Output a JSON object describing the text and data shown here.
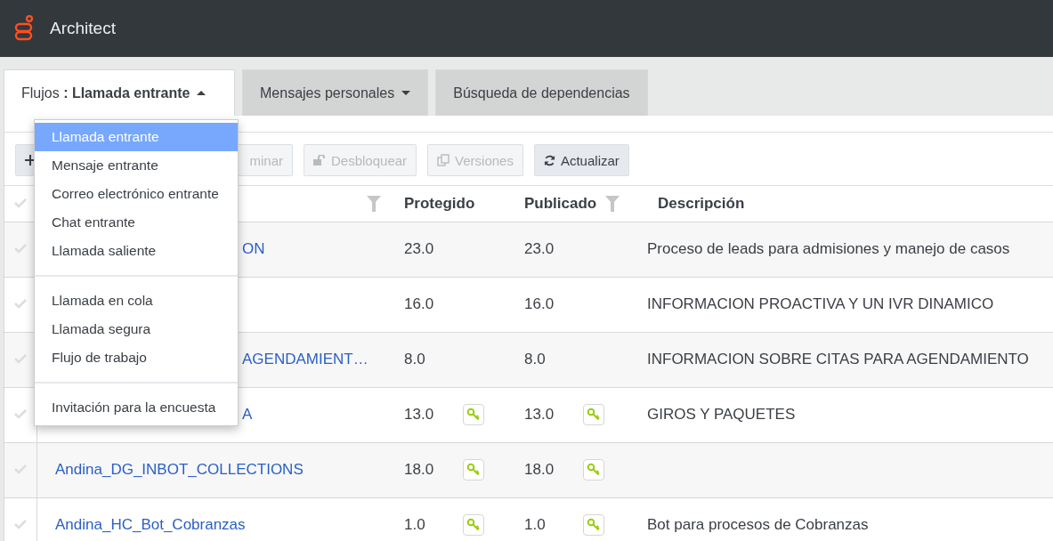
{
  "app": {
    "title": "Architect"
  },
  "tabs": [
    {
      "label": "Flujos **: Llamada entrante**",
      "selected": true,
      "expanded": true
    },
    {
      "label": "Mensajes personales",
      "selected": false,
      "expanded": false
    },
    {
      "label": "Búsqueda de dependencias",
      "selected": false
    }
  ],
  "flow_menu": {
    "groups": [
      [
        {
          "label": "Llamada entrante",
          "selected": true
        },
        {
          "label": "Mensaje entrante",
          "selected": false
        },
        {
          "label": "Correo electrónico entrante",
          "selected": false
        },
        {
          "label": "Chat entrante",
          "selected": false
        },
        {
          "label": "Llamada saliente",
          "selected": false
        }
      ],
      [
        {
          "label": "Llamada en cola",
          "selected": false
        },
        {
          "label": "Llamada segura",
          "selected": false
        },
        {
          "label": "Flujo de trabajo",
          "selected": false
        }
      ],
      [
        {
          "label": "Invitación para la encuesta",
          "selected": false
        }
      ]
    ]
  },
  "toolbar": [
    {
      "kind": "add",
      "disabled": false
    },
    {
      "kind": "delete",
      "label": "minar",
      "disabled": true
    },
    {
      "kind": "unlock",
      "label": "Desbloquear",
      "disabled": true
    },
    {
      "kind": "versions",
      "label": "Versiones",
      "disabled": true
    },
    {
      "kind": "refresh",
      "label": "Actualizar",
      "disabled": false
    }
  ],
  "table": {
    "columns": [
      {
        "filter": true
      },
      {
        "label": "Protegido",
        "filter": false
      },
      {
        "label": "Publicado",
        "filter": true
      },
      {
        "label": "Descripción",
        "filter": false
      }
    ],
    "rows": [
      {
        "name_fragment": "ON",
        "protected": "23.0",
        "protected_key": false,
        "published": "23.0",
        "published_key": false,
        "description": "Proceso de leads para admisiones y manejo de casos"
      },
      {
        "protected": "16.0",
        "protected_key": false,
        "published": "16.0",
        "published_key": false,
        "description": "INFORMACION PROACTIVA Y UN IVR DINAMICO"
      },
      {
        "name_fragment": "AGENDAMIENT…",
        "protected": "8.0",
        "protected_key": false,
        "published": "8.0",
        "published_key": false,
        "description": "INFORMACION SOBRE CITAS PARA AGENDAMIENTO"
      },
      {
        "name_fragment": "A",
        "protected": "13.0",
        "protected_key": true,
        "published": "13.0",
        "published_key": true,
        "description": "GIROS Y PAQUETES"
      },
      {
        "name": "Andina_DG_INBOT_COLLECTIONS",
        "protected": "18.0",
        "protected_key": true,
        "published": "18.0",
        "published_key": true
      },
      {
        "name": "Andina_HC_Bot_Cobranzas",
        "protected": "1.0",
        "protected_key": true,
        "published": "1.0",
        "published_key": true,
        "description": "Bot para procesos de Cobranzas"
      }
    ]
  }
}
